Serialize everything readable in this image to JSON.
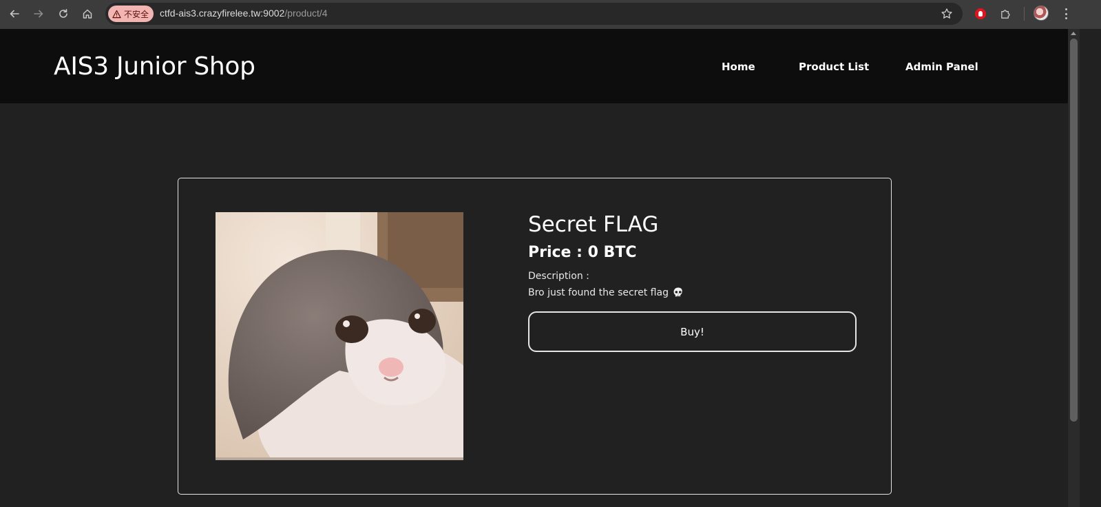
{
  "browser": {
    "security_label": "不安全",
    "url_host": "ctfd-ais3.crazyfirelee.tw:9002",
    "url_path": "/product/4",
    "icons": [
      "back-icon",
      "forward-icon",
      "reload-icon",
      "home-icon",
      "warning-icon",
      "star-icon",
      "extension-icon",
      "puzzle-icon",
      "avatar",
      "more-icon"
    ]
  },
  "site": {
    "brand": "AIS3 Junior Shop",
    "nav": [
      "Home",
      "Product List",
      "Admin Panel"
    ]
  },
  "product": {
    "title": "Secret FLAG",
    "price": "Price : 0 BTC",
    "description_label": "Description :",
    "description": "Bro just found the secret flag",
    "description_emoji": "skull-icon",
    "buy_label": "Buy!",
    "image": "cat-photo"
  },
  "colors": {
    "page_bg": "#212121",
    "header_bg": "#0d0d0d",
    "text": "#ffffff",
    "border": "#e6e6e6",
    "security_chip": "#f3b5b2"
  }
}
